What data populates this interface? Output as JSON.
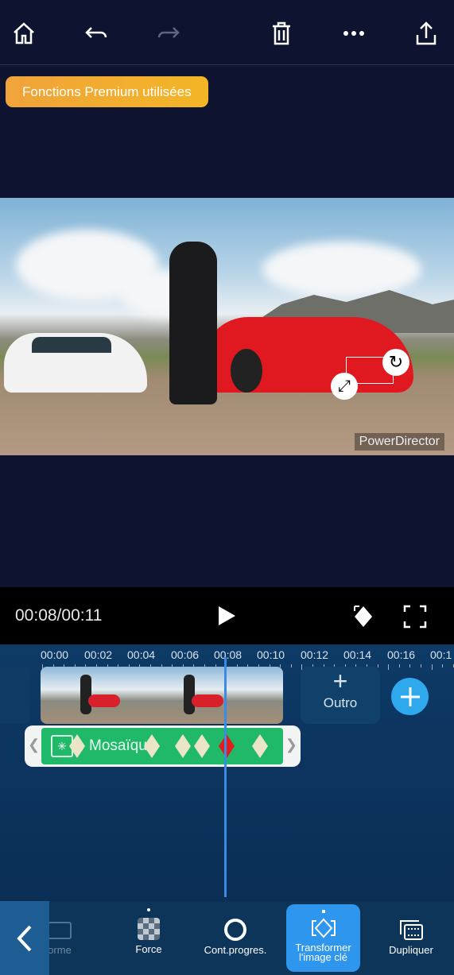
{
  "topbar": {
    "icons": [
      "home-icon",
      "undo-icon",
      "redo-icon",
      "trash-icon",
      "more-icon",
      "share-icon"
    ]
  },
  "premium_label": "Fonctions Premium utilisées",
  "preview": {
    "watermark": "PowerDirector"
  },
  "playback": {
    "time": "00:08/00:11"
  },
  "timeline": {
    "ruler": [
      "00:00",
      "00:02",
      "00:04",
      "00:06",
      "00:08",
      "00:10",
      "00:12",
      "00:14",
      "00:16",
      "00:1"
    ],
    "outro_label": "Outro",
    "effect_label": "Mosaïque",
    "keyframes": 7,
    "selected_keyframe": 5
  },
  "toolbar": {
    "items": [
      {
        "label": "orme",
        "icon": "shape-icon"
      },
      {
        "label": "Force",
        "icon": "mosaic-icon"
      },
      {
        "label": "Cont.progres.",
        "icon": "circle-icon"
      },
      {
        "label": "Transformer l'image clé",
        "icon": "keyframe-transform-icon",
        "active": true
      },
      {
        "label": "Dupliquer",
        "icon": "duplicate-icon"
      }
    ]
  },
  "colors": {
    "accent": "#2fa9ee",
    "effect": "#20b96a",
    "premium": "#f0a33a",
    "keyframe_selected": "#e21b1b"
  }
}
